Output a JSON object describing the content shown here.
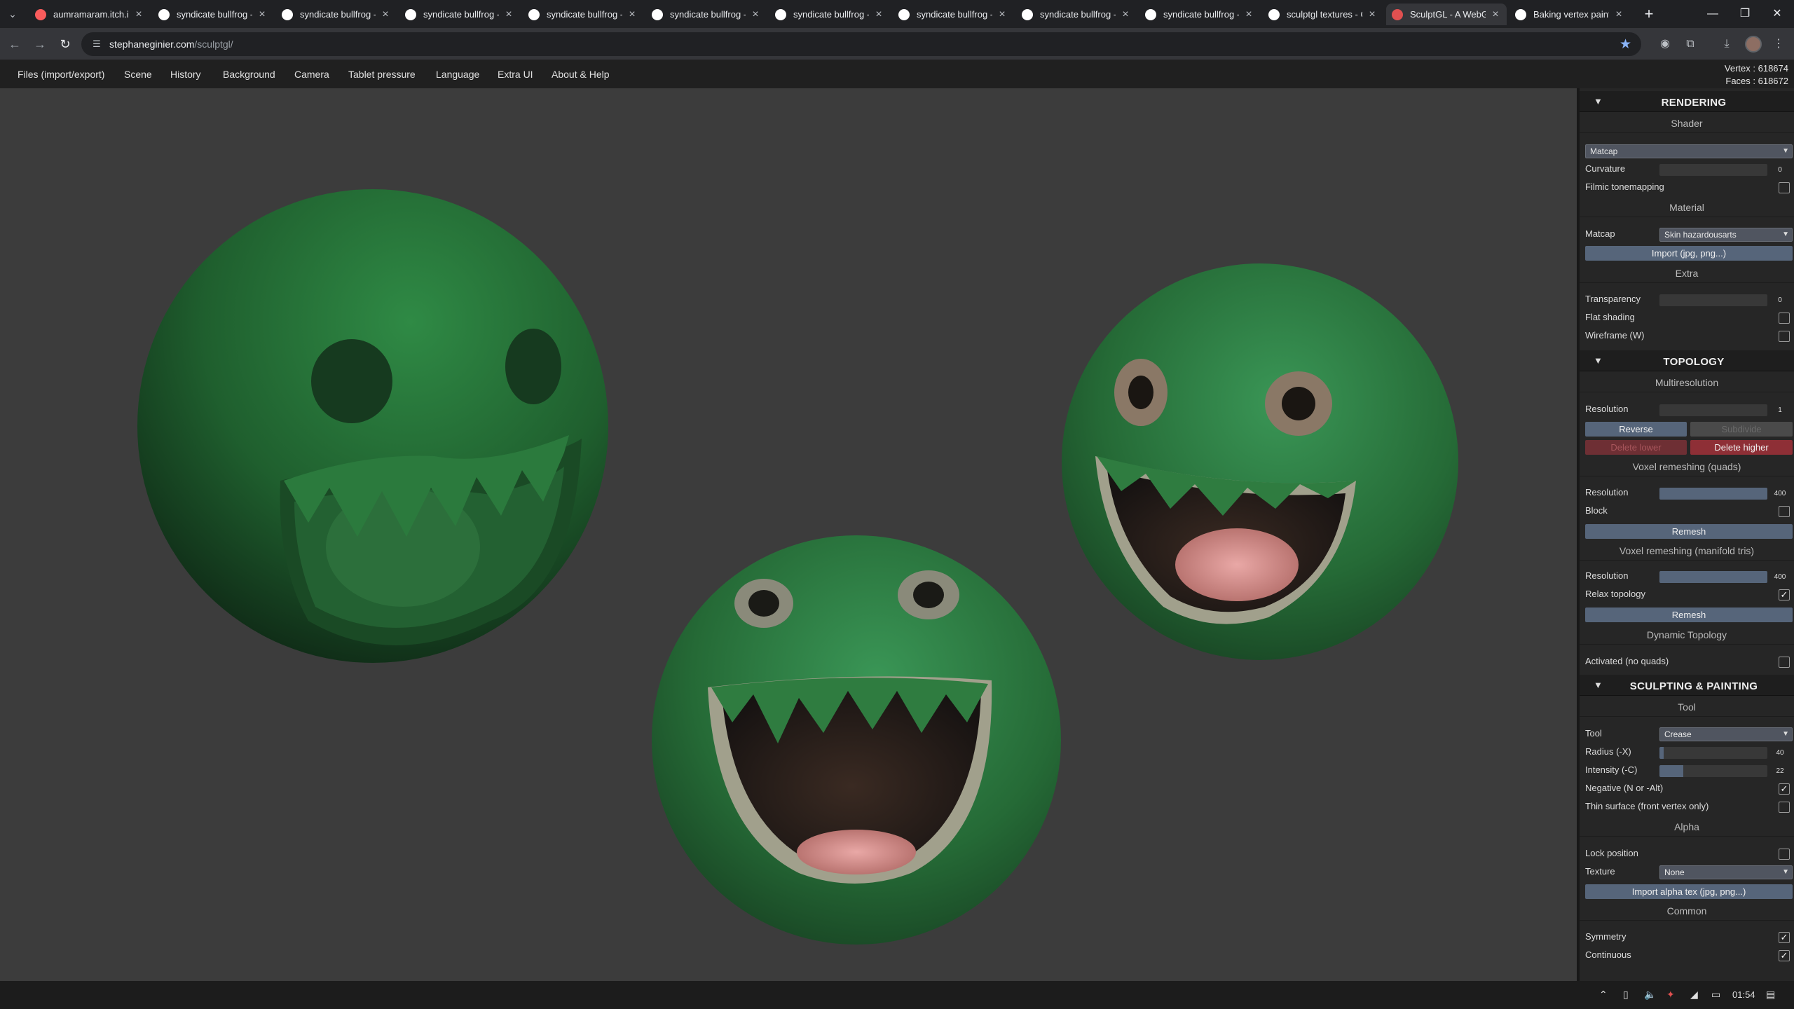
{
  "browser": {
    "tabs": [
      {
        "title": "aumramaram.itch.io",
        "icon": "itch-icon",
        "color": "#fa5c5c",
        "active": false
      },
      {
        "title": "syndicate bullfrog - Google",
        "icon": "google-icon",
        "color": "#ffffff",
        "active": false
      },
      {
        "title": "syndicate bullfrog - Google",
        "icon": "google-icon",
        "color": "#ffffff",
        "active": false
      },
      {
        "title": "syndicate bullfrog - Google",
        "icon": "google-icon",
        "color": "#ffffff",
        "active": false
      },
      {
        "title": "syndicate bullfrog - Google",
        "icon": "google-icon",
        "color": "#ffffff",
        "active": false
      },
      {
        "title": "syndicate bullfrog - Google",
        "icon": "google-icon",
        "color": "#ffffff",
        "active": false
      },
      {
        "title": "syndicate bullfrog - Google",
        "icon": "google-icon",
        "color": "#ffffff",
        "active": false
      },
      {
        "title": "syndicate bullfrog - Google",
        "icon": "google-icon",
        "color": "#ffffff",
        "active": false
      },
      {
        "title": "syndicate bullfrog - Google",
        "icon": "google-icon",
        "color": "#ffffff",
        "active": false
      },
      {
        "title": "syndicate bullfrog - Google",
        "icon": "google-icon",
        "color": "#ffffff",
        "active": false
      },
      {
        "title": "sculptgl textures - Google",
        "icon": "google-icon",
        "color": "#ffffff",
        "active": false
      },
      {
        "title": "SculptGL - A WebGL",
        "icon": "sculptgl-icon",
        "color": "#e05050",
        "active": true
      },
      {
        "title": "Baking vertex paint",
        "icon": "github-icon",
        "color": "#ffffff",
        "active": false
      }
    ],
    "url_host": "stephaneginier.com",
    "url_path": "/sculptgl/"
  },
  "menu": [
    "Files (import/export)",
    "Scene",
    "History",
    "Background",
    "Camera",
    "Tablet pressure",
    "Language",
    "Extra UI",
    "About & Help"
  ],
  "stats": {
    "vertex": "Vertex : 618674",
    "faces": "Faces : 618672"
  },
  "panel": {
    "rendering": {
      "title": "RENDERING",
      "shader_head": "Shader",
      "shader_value": "Matcap",
      "curvature_label": "Curvature",
      "curvature_value": "0",
      "curvature_level": 0,
      "filmic_label": "Filmic tonemapping",
      "filmic_checked": false,
      "material_head": "Material",
      "matcap_label": "Matcap",
      "matcap_value": "Skin hazardousarts",
      "import_label": "Import (jpg, png...)",
      "extra_head": "Extra",
      "transparency_label": "Transparency",
      "transparency_value": "0",
      "transparency_level": 0,
      "flat_label": "Flat shading",
      "flat_checked": false,
      "wire_label": "Wireframe (W)",
      "wire_checked": false
    },
    "topology": {
      "title": "TOPOLOGY",
      "multires_head": "Multiresolution",
      "res_label": "Resolution",
      "res_value": "1",
      "res_level": 0,
      "reverse_label": "Reverse",
      "subdivide_label": "Subdivide",
      "delete_lower_label": "Delete lower",
      "delete_higher_label": "Delete higher",
      "voxel_quads_head": "Voxel remeshing (quads)",
      "vq_res_label": "Resolution",
      "vq_res_value": "400",
      "vq_res_level": 1.0,
      "block_label": "Block",
      "block_checked": false,
      "remesh_label": "Remesh",
      "voxel_tris_head": "Voxel remeshing (manifold tris)",
      "vt_res_label": "Resolution",
      "vt_res_value": "400",
      "vt_res_level": 1.0,
      "relax_label": "Relax topology",
      "relax_checked": true,
      "remesh2_label": "Remesh",
      "dyn_head": "Dynamic Topology",
      "activated_label": "Activated (no quads)",
      "activated_checked": false
    },
    "sculpt": {
      "title": "SCULPTING & PAINTING",
      "tool_head": "Tool",
      "tool_label": "Tool",
      "tool_value": "Crease",
      "radius_label": "Radius (-X)",
      "radius_value": "40",
      "radius_level": 0.04,
      "intensity_label": "Intensity (-C)",
      "intensity_value": "22",
      "intensity_level": 0.22,
      "negative_label": "Negative (N or -Alt)",
      "negative_checked": true,
      "thin_label": "Thin surface (front vertex only)",
      "thin_checked": false,
      "alpha_head": "Alpha",
      "lock_label": "Lock position",
      "lock_checked": false,
      "texture_label": "Texture",
      "texture_value": "None",
      "import_alpha_label": "Import alpha tex (jpg, png...)",
      "common_head": "Common",
      "symmetry_label": "Symmetry",
      "symmetry_checked": true,
      "continuous_label": "Continuous",
      "continuous_checked": true
    }
  },
  "taskbar": {
    "time": "01:54"
  }
}
